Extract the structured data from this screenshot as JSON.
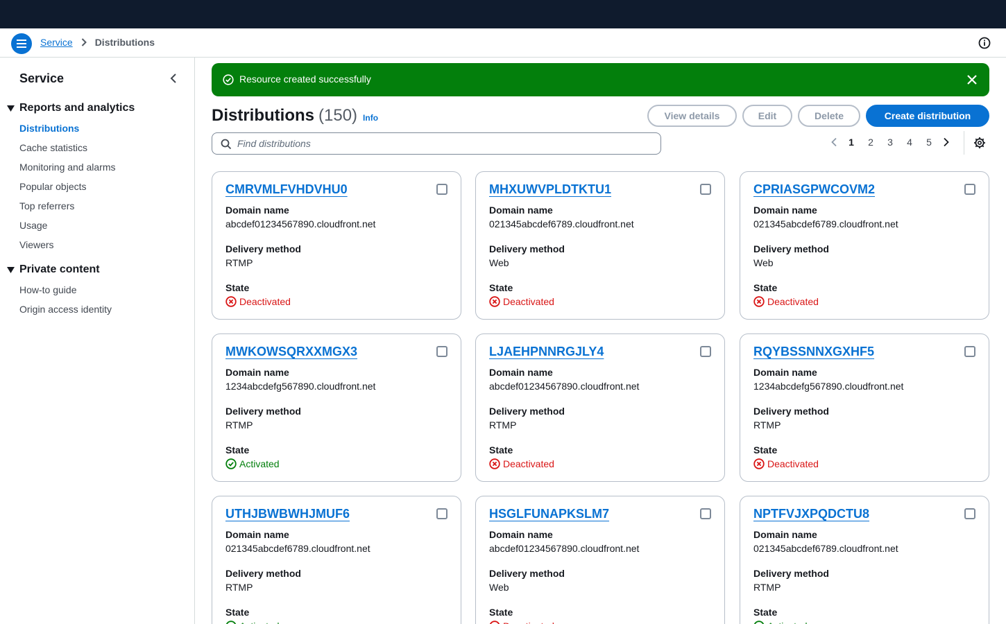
{
  "breadcrumb": {
    "service": "Service",
    "current": "Distributions"
  },
  "sidebar": {
    "title": "Service",
    "sections": [
      {
        "label": "Reports and analytics",
        "items": [
          "Distributions",
          "Cache statistics",
          "Monitoring and alarms",
          "Popular objects",
          "Top referrers",
          "Usage",
          "Viewers"
        ]
      },
      {
        "label": "Private content",
        "items": [
          "How-to guide",
          "Origin access identity"
        ]
      }
    ],
    "active_item": "Distributions"
  },
  "flash": {
    "message": "Resource created successfully",
    "color": "#037f0c"
  },
  "header": {
    "title": "Distributions",
    "count": "(150)",
    "info": "Info",
    "buttons": {
      "view_details": "View details",
      "edit": "Edit",
      "delete": "Delete",
      "create": "Create distribution"
    }
  },
  "search": {
    "placeholder": "Find distributions",
    "value": ""
  },
  "pagination": {
    "pages": [
      "1",
      "2",
      "3",
      "4",
      "5"
    ],
    "current": "1"
  },
  "labels": {
    "domain": "Domain name",
    "delivery": "Delivery method",
    "state": "State"
  },
  "cards": [
    {
      "id": "CMRVMLFVHDVHU0",
      "domain": "abcdef01234567890.cloudfront.net",
      "delivery": "RTMP",
      "state": "Deactivated",
      "status": "deactivated"
    },
    {
      "id": "MHXUWVPLDTKTU1",
      "domain": "021345abcdef6789.cloudfront.net",
      "delivery": "Web",
      "state": "Deactivated",
      "status": "deactivated"
    },
    {
      "id": "CPRIASGPWCOVM2",
      "domain": "021345abcdef6789.cloudfront.net",
      "delivery": "Web",
      "state": "Deactivated",
      "status": "deactivated"
    },
    {
      "id": "MWKOWSQRXXMGX3",
      "domain": "1234abcdefg567890.cloudfront.net",
      "delivery": "RTMP",
      "state": "Activated",
      "status": "activated"
    },
    {
      "id": "LJAEHPNNRGJLY4",
      "domain": "abcdef01234567890.cloudfront.net",
      "delivery": "RTMP",
      "state": "Deactivated",
      "status": "deactivated"
    },
    {
      "id": "RQYBSSNNXGXHF5",
      "domain": "1234abcdefg567890.cloudfront.net",
      "delivery": "RTMP",
      "state": "Deactivated",
      "status": "deactivated"
    },
    {
      "id": "UTHJBWBWHJMUF6",
      "domain": "021345abcdef6789.cloudfront.net",
      "delivery": "RTMP",
      "state": "Activated",
      "status": "activated"
    },
    {
      "id": "HSGLFUNAPKSLM7",
      "domain": "abcdef01234567890.cloudfront.net",
      "delivery": "Web",
      "state": "Deactivated",
      "status": "deactivated"
    },
    {
      "id": "NPTFVJXPQDCTU8",
      "domain": "021345abcdef6789.cloudfront.net",
      "delivery": "RTMP",
      "state": "Activated",
      "status": "activated"
    }
  ],
  "colors": {
    "link": "#0972d3",
    "error": "#d91515",
    "success": "#037f0c",
    "topbar": "#0f1b2d"
  }
}
